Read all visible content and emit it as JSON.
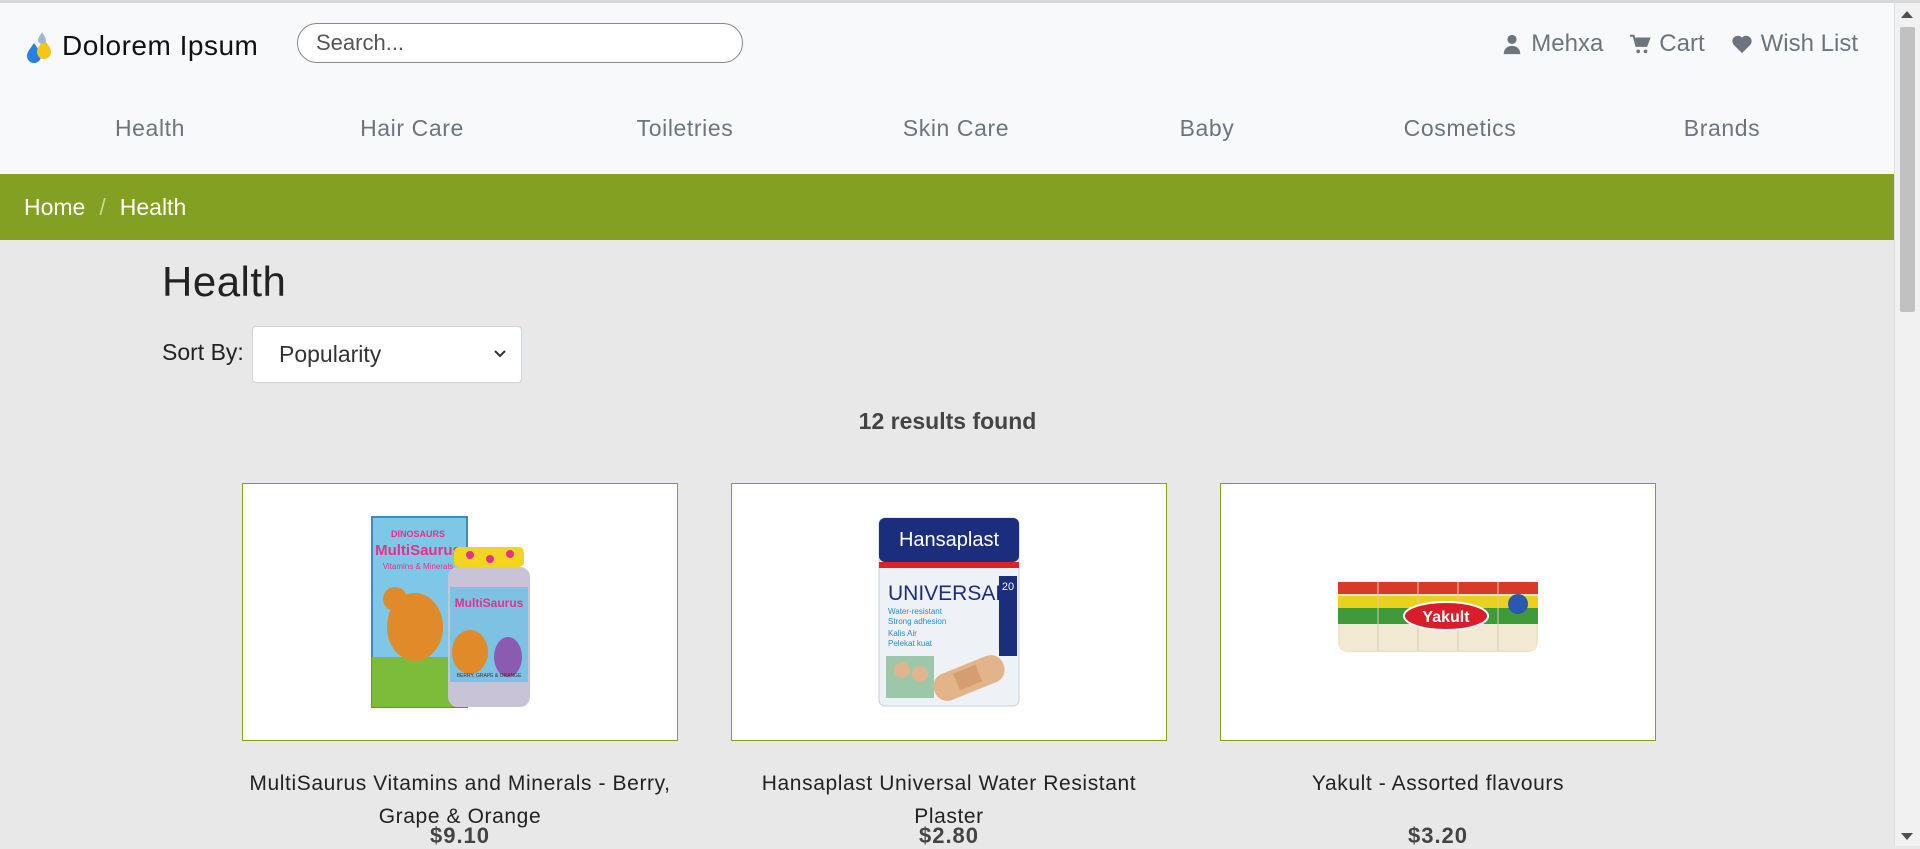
{
  "header": {
    "brand": "Dolorem Ipsum",
    "search_placeholder": "Search...",
    "user_nav": [
      {
        "icon": "user-icon",
        "label": "Mehxa"
      },
      {
        "icon": "cart-icon",
        "label": "Cart"
      },
      {
        "icon": "heart-icon",
        "label": "Wish List"
      }
    ]
  },
  "categories": [
    "Health",
    "Hair Care",
    "Toiletries",
    "Skin Care",
    "Baby",
    "Cosmetics",
    "Brands"
  ],
  "breadcrumb": {
    "home": "Home",
    "separator": "/",
    "current": "Health"
  },
  "main": {
    "title": "Health",
    "sort_label": "Sort By:",
    "sort_value": "Popularity",
    "results_text": "12 results found"
  },
  "products": [
    {
      "name": "MultiSaurus Vitamins and Minerals - Berry, Grape & Orange",
      "price": "$9.10"
    },
    {
      "name": "Hansaplast Universal Water Resistant Plaster",
      "price": "$2.80"
    },
    {
      "name": "Yakult - Assorted flavours",
      "price": "$3.20"
    }
  ],
  "product_image_text": {
    "multisaurus": {
      "brand": "DINOSAURS",
      "name": "MultiSaurus",
      "line": "Vitamins & Minerals",
      "flavour": "BERRY, GRAPE & ORANGE"
    },
    "hansaplast": {
      "brand": "Hansaplast",
      "name": "UNIVERSAL",
      "count": "20",
      "lines": [
        "Water-resistant",
        "Strong adhesion",
        "Kalis Air",
        "Pelekat kuat"
      ]
    },
    "yakult": {
      "brand": "Yakult"
    }
  },
  "colors": {
    "accent_green": "#83a023",
    "muted_text": "#6c757d",
    "background": "#e8e8e8"
  }
}
